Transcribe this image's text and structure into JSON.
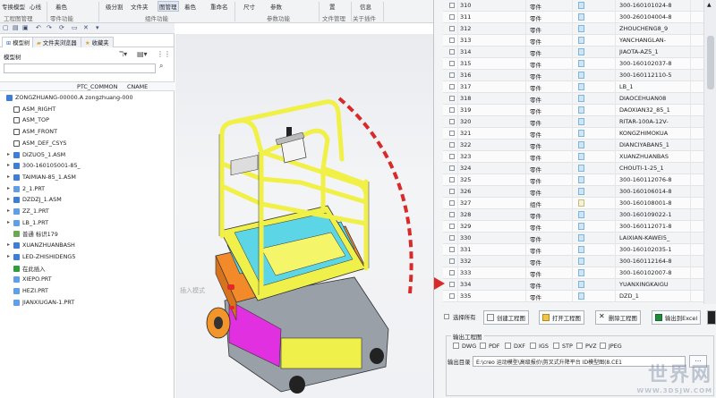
{
  "ribbon": {
    "items": [
      "专换模型",
      "心线",
      "着色",
      "级分割",
      "文件夹",
      "图管理",
      "着色",
      "重命名",
      "尺寸",
      "参数",
      "置",
      "信息"
    ],
    "groups": [
      "工程图管理",
      "零件功能",
      "组件功能",
      "参数功能",
      "文件管理",
      "关于插件"
    ],
    "selected": "图管理"
  },
  "model_tree": {
    "tabs": [
      "模型树",
      "文件夹浏览器",
      "收藏夹"
    ],
    "label": "模型树",
    "columns": [
      "PTC_COMMON",
      "CNAME"
    ],
    "items": [
      {
        "text": "ZONGZHUANG-00000.A zongzhuang-000",
        "icon": "assembly-icon",
        "expand": "",
        "indent": 0
      },
      {
        "text": "ASM_RIGHT",
        "icon": "datum-plane-icon",
        "expand": "",
        "indent": 1
      },
      {
        "text": "ASM_TOP",
        "icon": "datum-plane-icon",
        "expand": "",
        "indent": 1
      },
      {
        "text": "ASM_FRONT",
        "icon": "datum-plane-icon",
        "expand": "",
        "indent": 1
      },
      {
        "text": "ASM_DEF_CSYS",
        "icon": "csys-icon",
        "expand": "",
        "indent": 1
      },
      {
        "text": "DIZUO5_1.ASM",
        "icon": "assembly-icon",
        "expand": "▸",
        "indent": 1
      },
      {
        "text": "300-160105001-85_",
        "icon": "assembly-icon",
        "expand": "▸",
        "indent": 1
      },
      {
        "text": "TAIMIAN-85_1.ASM",
        "icon": "assembly-icon",
        "expand": "▸",
        "indent": 1
      },
      {
        "text": "2_1.PRT",
        "icon": "part-icon",
        "expand": "▸",
        "indent": 1
      },
      {
        "text": "DZDZJ_1.ASM",
        "icon": "assembly-icon",
        "expand": "▸",
        "indent": 1
      },
      {
        "text": "ZZ_1.PRT",
        "icon": "part-icon",
        "expand": "▸",
        "indent": 1
      },
      {
        "text": "LB_1.PRT",
        "icon": "part-icon",
        "expand": "▸",
        "indent": 1
      },
      {
        "text": "普通 标识179",
        "icon": "feature-icon",
        "expand": "",
        "indent": 1
      },
      {
        "text": "XUANZHUANBASH",
        "icon": "assembly-icon",
        "expand": "▸",
        "indent": 1
      },
      {
        "text": "LED-ZHISHIDENG5",
        "icon": "assembly-icon",
        "expand": "▸",
        "indent": 1
      },
      {
        "text": "在此插入",
        "icon": "insert-here-icon",
        "expand": "",
        "indent": 1
      },
      {
        "text": "XIEPO.PRT",
        "icon": "part-icon",
        "expand": "",
        "indent": 1
      },
      {
        "text": "HEZI.PRT",
        "icon": "part-icon",
        "expand": "",
        "indent": 1
      },
      {
        "text": "JIANXIUGAN-1.PRT",
        "icon": "part-icon",
        "expand": "",
        "indent": 1
      }
    ]
  },
  "viewport": {
    "insert_hint": "插入模式"
  },
  "parts_table": {
    "rows": [
      {
        "num": "310",
        "type": "零件",
        "name": "300-160101024-8",
        "doc": false
      },
      {
        "num": "311",
        "type": "零件",
        "name": "300-260104004-8",
        "doc": false
      },
      {
        "num": "312",
        "type": "零件",
        "name": "ZHOUCHENG8_9",
        "doc": false
      },
      {
        "num": "313",
        "type": "零件",
        "name": "YANCHANGLAN-",
        "doc": false
      },
      {
        "num": "314",
        "type": "零件",
        "name": "JIAOTA-AZ5_1",
        "doc": false
      },
      {
        "num": "315",
        "type": "零件",
        "name": "300-160102037-8",
        "doc": false
      },
      {
        "num": "316",
        "type": "零件",
        "name": "300-160112110-5",
        "doc": false
      },
      {
        "num": "317",
        "type": "零件",
        "name": "LB_1",
        "doc": false
      },
      {
        "num": "318",
        "type": "零件",
        "name": "DIAOCEHUAN08",
        "doc": false
      },
      {
        "num": "319",
        "type": "零件",
        "name": "DAOXIAN32_85_1",
        "doc": false
      },
      {
        "num": "320",
        "type": "零件",
        "name": "RITAR-100A-12V-",
        "doc": false
      },
      {
        "num": "321",
        "type": "零件",
        "name": "KONGZHIMOKUA",
        "doc": false
      },
      {
        "num": "322",
        "type": "零件",
        "name": "DIANCIYABAN5_1",
        "doc": false
      },
      {
        "num": "323",
        "type": "零件",
        "name": "XUANZHUANBAS",
        "doc": false
      },
      {
        "num": "324",
        "type": "零件",
        "name": "CHOUTI-1-25_1",
        "doc": false
      },
      {
        "num": "325",
        "type": "零件",
        "name": "300-160112076-8",
        "doc": false
      },
      {
        "num": "326",
        "type": "零件",
        "name": "300-160106014-8",
        "doc": false
      },
      {
        "num": "327",
        "type": "组件",
        "name": "300-160108001-8",
        "doc": true
      },
      {
        "num": "328",
        "type": "零件",
        "name": "300-160109022-1",
        "doc": false
      },
      {
        "num": "329",
        "type": "零件",
        "name": "300-160112071-8",
        "doc": false
      },
      {
        "num": "330",
        "type": "零件",
        "name": "LAIXIAN-KAWEI5_",
        "doc": false
      },
      {
        "num": "331",
        "type": "零件",
        "name": "300-160102035-1",
        "doc": false
      },
      {
        "num": "332",
        "type": "零件",
        "name": "300-160112164-8",
        "doc": false
      },
      {
        "num": "333",
        "type": "零件",
        "name": "300-160102007-8",
        "doc": false
      },
      {
        "num": "334",
        "type": "零件",
        "name": "YUANXINGKAIGU",
        "doc": false
      },
      {
        "num": "335",
        "type": "零件",
        "name": "DZD_1",
        "doc": false
      }
    ]
  },
  "actions": {
    "select_all": "选择所有",
    "create_drawing": "创建工程图",
    "open_drawing": "打开工程图",
    "delete_drawing": "删除工程图",
    "export_excel": "输出到Excel"
  },
  "export_group": {
    "title": "输出工程图",
    "formats": [
      "DWG",
      "PDF",
      "DXF",
      "IGS",
      "STP",
      "PVZ",
      "JPEG"
    ],
    "dir_label": "输出目录",
    "dir_value": "E:\\creo 运动模型\\高级报价\\剪叉式升降平台 ID模型图(8.CE1"
  },
  "watermark": {
    "logo": "世界网",
    "url": "WWW.3DSJW.COM"
  },
  "colors": {
    "ribbon_bg": "#f2f3f5",
    "arrow": "#d92a2a",
    "machine_yellow": "#f0f04a",
    "machine_orange": "#f28a2a",
    "machine_magenta": "#e030e0",
    "machine_cyan": "#58d8e8"
  }
}
